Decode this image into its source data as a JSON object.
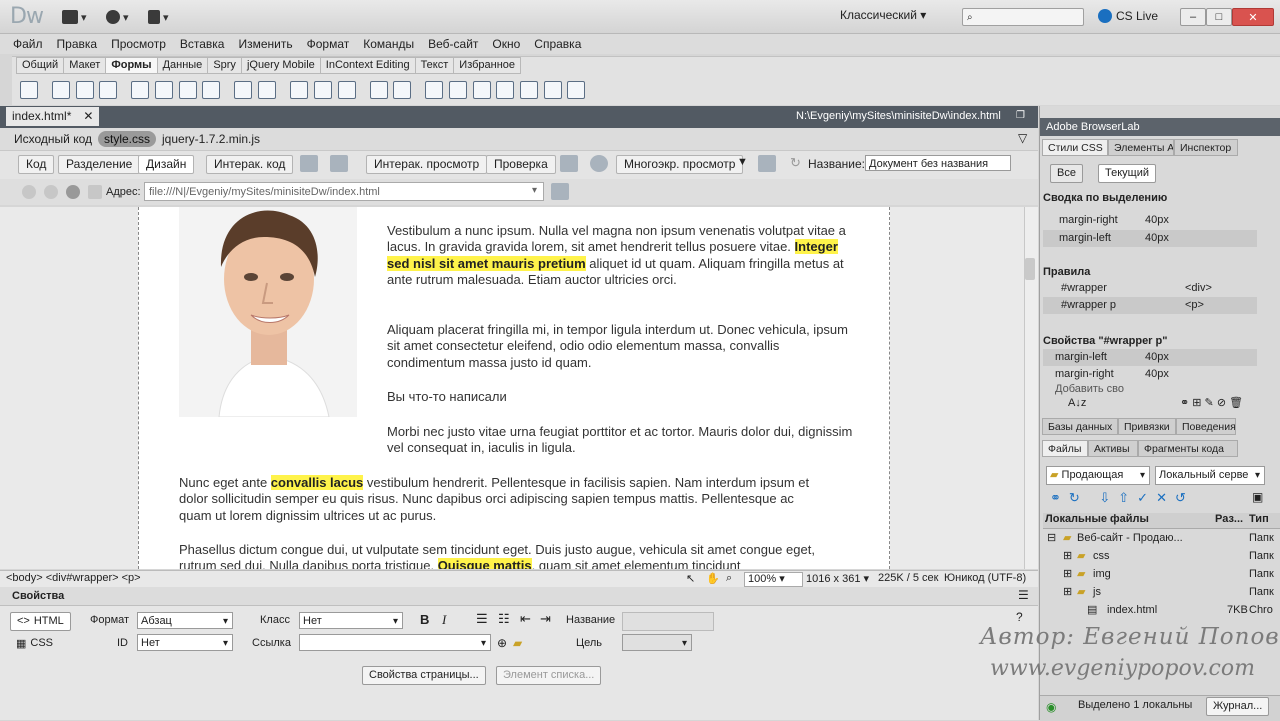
{
  "app": {
    "logo": "Dw",
    "workspace": "Классический",
    "cs_live": "CS Live"
  },
  "menu": [
    "Файл",
    "Правка",
    "Просмотр",
    "Вставка",
    "Изменить",
    "Формат",
    "Команды",
    "Веб-сайт",
    "Окно",
    "Справка"
  ],
  "insert_tabs": [
    "Общий",
    "Макет",
    "Формы",
    "Данные",
    "Spry",
    "jQuery Mobile",
    "InContext Editing",
    "Текст",
    "Избранное"
  ],
  "document": {
    "tab": "index.html*",
    "path": "N:\\Evgeniy\\mySites\\minisiteDw\\index.html",
    "related_files": [
      "Исходный код",
      "style.css",
      "jquery-1.7.2.min.js"
    ]
  },
  "doc_toolbar": {
    "code": "Код",
    "split": "Разделение",
    "design": "Дизайн",
    "live_code": "Интерак. код",
    "live_view": "Интерак. просмотр",
    "inspect": "Проверка",
    "multiscreen": "Многоэкр. просмотр",
    "title_label": "Название:",
    "title_value": "Документ без названия"
  },
  "address": {
    "label": "Адрес:",
    "value": "file:///N|/Evgeniy/mySites/minisiteDw/index.html"
  },
  "content": {
    "p1_a": "Vestibulum a nunc ipsum. Nulla vel magna non ipsum venenatis volutpat vitae a lacus. In gravida gravida lorem, sit amet hendrerit tellus posuere vitae. ",
    "p1_hl": "Integer sed nisl sit amet mauris pretium",
    "p1_b": " aliquet id ut quam. Aliquam fringilla metus at ante rutrum malesuada. Etiam auctor ultricies orci.",
    "p2": "Aliquam placerat fringilla mi, in tempor ligula interdum ut. Donec vehicula, ipsum sit amet consectetur eleifend, odio odio elementum massa, convallis condimentum massa justo id quam.",
    "p3": "Вы что-то написали",
    "p4": "Morbi nec justo vitae urna feugiat porttitor et ac tortor. Mauris dolor dui, dignissim vel consequat in, iaculis in ligula.",
    "p5_a": "Nunc eget ante ",
    "p5_hl": "convallis lacus",
    "p5_b": " vestibulum hendrerit. Pellentesque in facilisis sapien. Nam interdum ipsum et dolor sollicitudin semper eu quis risus. Nunc dapibus orci adipiscing sapien tempus mattis. Pellentesque ac quam ut lorem dignissim ultrices ut ac purus.",
    "p6_a": "Phasellus dictum congue dui, ut vulputate sem tincidunt eget. Duis justo augue, vehicula sit amet congue eget, rutrum sed dui. Nulla dapibus porta tristique. ",
    "p6_hl": "Quisque mattis",
    "p6_b": ", quam sit amet elementum tincidunt"
  },
  "status": {
    "tags": "<body> <div#wrapper> <p>",
    "zoom": "100%",
    "size": "1016 x 361",
    "weight": "225K / 5 сек",
    "encoding": "Юникод (UTF-8)"
  },
  "properties": {
    "title": "Свойства",
    "html": "HTML",
    "css": "CSS",
    "format_label": "Формат",
    "format_value": "Абзац",
    "class_label": "Класс",
    "class_value": "Нет",
    "id_label": "ID",
    "id_value": "Нет",
    "link_label": "Ссылка",
    "name_label": "Название",
    "target_label": "Цель",
    "page_props": "Свойства страницы...",
    "list_item": "Элемент списка..."
  },
  "right_panel": {
    "browserlab": "Adobe BrowserLab",
    "tabs1": [
      "Стили CSS",
      "Элементы А",
      "Инспектор"
    ],
    "all": "Все",
    "current": "Текущий",
    "summary_title": "Сводка по выделению",
    "summary": [
      {
        "p": "margin-right",
        "v": "40px"
      },
      {
        "p": "margin-left",
        "v": "40px"
      }
    ],
    "rules_title": "Правила",
    "rules": [
      {
        "s": "#wrapper",
        "t": "<div>"
      },
      {
        "s": "#wrapper p",
        "t": "<p>"
      }
    ],
    "props_title": "Свойства \"#wrapper p\"",
    "props": [
      {
        "p": "margin-left",
        "v": "40px"
      },
      {
        "p": "margin-right",
        "v": "40px"
      }
    ],
    "add_prop": "Добавить сво",
    "tabs2": [
      "Базы данных",
      "Привязки",
      "Поведения"
    ],
    "tabs3": [
      "Файлы",
      "Активы",
      "Фрагменты кода"
    ],
    "site": "Продающая",
    "server": "Локальный серве",
    "files_header": {
      "name": "Локальные файлы",
      "size": "Раз...",
      "type": "Тип"
    },
    "files": [
      {
        "name": "Веб-сайт - Продаю...",
        "size": "",
        "type": "Папк"
      },
      {
        "name": "css",
        "size": "",
        "type": "Папк"
      },
      {
        "name": "img",
        "size": "",
        "type": "Папк"
      },
      {
        "name": "js",
        "size": "",
        "type": "Папк"
      },
      {
        "name": "index.html",
        "size": "7KB",
        "type": "Chro"
      }
    ],
    "footer_status": "Выделено 1 локальны",
    "journal": "Журнал..."
  },
  "watermark": {
    "line1": "Автор: Евгений Попов",
    "line2": "www.evgeniypopov.com"
  }
}
